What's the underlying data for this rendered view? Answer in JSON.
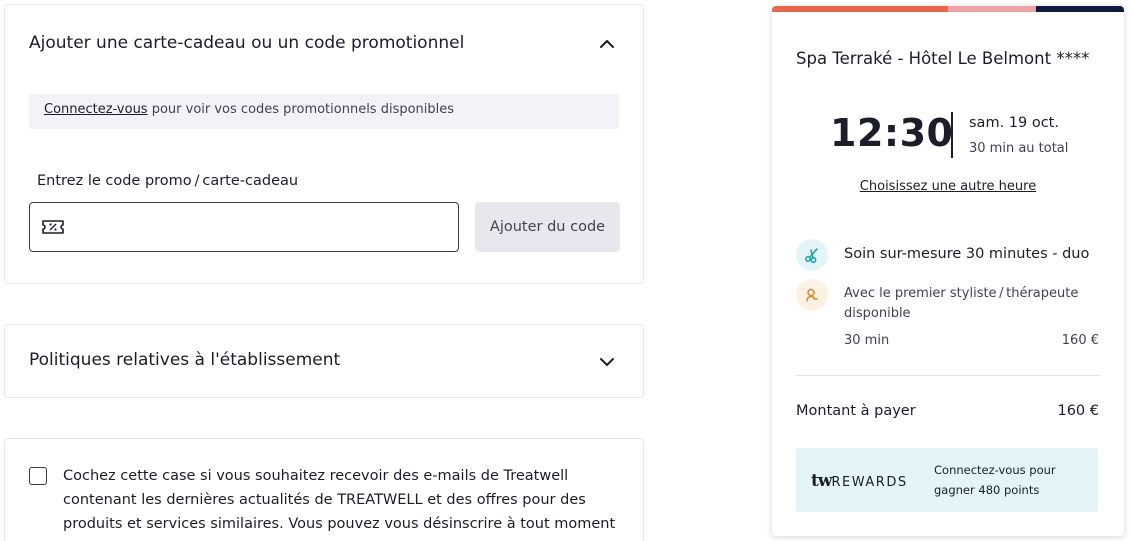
{
  "promo": {
    "title": "Ajouter une carte-cadeau ou un code promotionnel",
    "login_link": "Connectez-vous",
    "login_text": " pour voir vos codes promotionnels disponibles",
    "field_label": "Entrez le code promo / carte-cadeau",
    "input_value": "",
    "input_placeholder": "",
    "add_button": "Ajouter du code"
  },
  "policies": {
    "title": "Politiques relatives à l'établissement"
  },
  "newsletter": {
    "checked": false,
    "text": "Cochez cette case si vous souhaitez recevoir des e-mails de Treatwell contenant les dernières actualités de TREATWELL et des offres pour des produits et services similaires. Vous pouvez vous désinscrire à tout moment"
  },
  "summary": {
    "stripe_colors": [
      "#e8674a",
      "#f0a3a6",
      "#0f1a3c"
    ],
    "venue": "Spa Terraké - Hôtel Le Belmont ****",
    "time": "12:30",
    "date": "sam. 19 oct.",
    "total_duration": "30 min au total",
    "other_time_link": "Choisissez une autre heure",
    "service": {
      "name": "Soin sur-mesure 30 minutes - duo",
      "icon": "scissors-icon",
      "icon_bg": "#e3f5f6",
      "icon_color": "#16a1a8"
    },
    "staff": {
      "text": "Avec le premier styliste / thérapeute disponible",
      "icon": "person-icon",
      "icon_bg": "#fdf1e3",
      "icon_color": "#d98a2b"
    },
    "duration": "30 min",
    "price": "160 €",
    "total_label": "Montant à payer",
    "total_value": "160 €",
    "rewards": {
      "logo_tw": "tw",
      "logo_rewards": "REWARDS",
      "text": "Connectez-vous pour gagner 480 points"
    }
  }
}
